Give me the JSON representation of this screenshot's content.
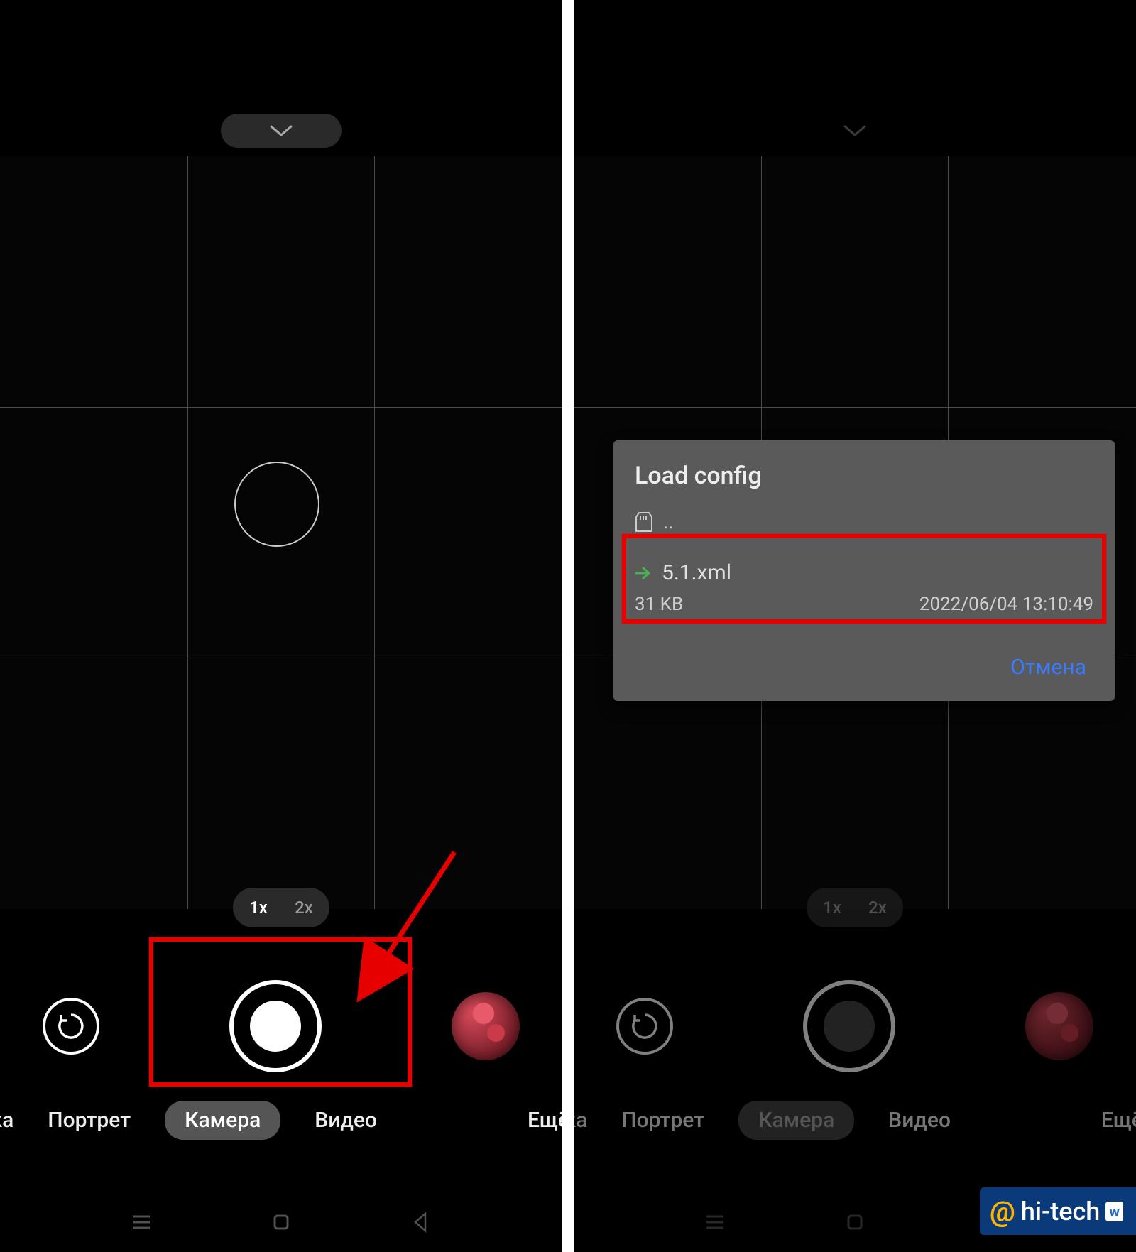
{
  "left": {
    "zoom": {
      "opt1": "1x",
      "opt2": "2x",
      "active": "1x"
    },
    "modes": {
      "partial_left": "мка",
      "item1": "Портрет",
      "active": "Камера",
      "item3": "Видео",
      "partial_right": "Ещё"
    }
  },
  "right": {
    "zoom": {
      "opt1": "1x",
      "opt2": "2x"
    },
    "modes": {
      "partial_left": "мка",
      "item1": "Портрет",
      "active": "Камера",
      "item3": "Видео",
      "partial_right": "Ещё"
    },
    "dialog": {
      "title": "Load config",
      "parent": "..",
      "file": {
        "name": "5.1.xml",
        "size": "31 KB",
        "date": "2022/06/04 13:10:49"
      },
      "cancel": "Отмена"
    }
  },
  "watermark": {
    "at": "@",
    "text": "hi-tech",
    "vk": "w"
  }
}
